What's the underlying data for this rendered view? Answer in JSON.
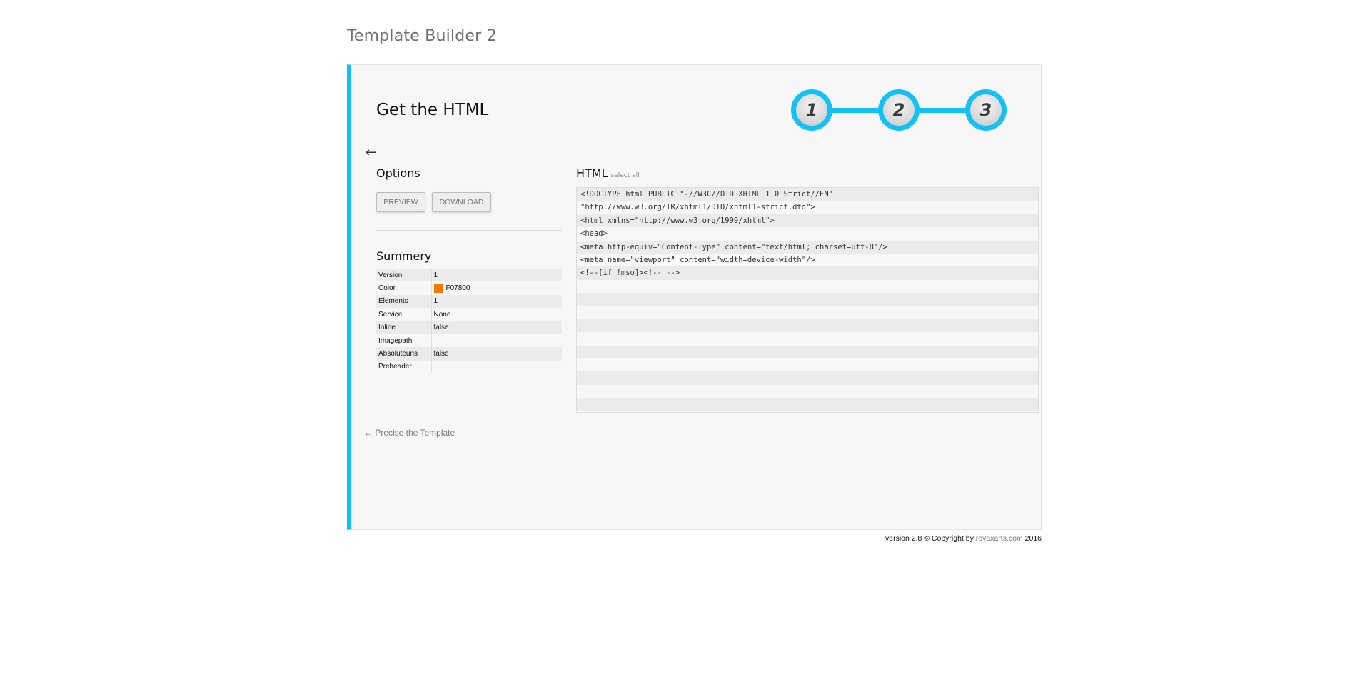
{
  "app": {
    "title": "Template Builder 2"
  },
  "page": {
    "title": "Get the HTML",
    "back_arrow": "←"
  },
  "steps": [
    {
      "number": "1"
    },
    {
      "number": "2"
    },
    {
      "number": "3"
    }
  ],
  "options": {
    "heading": "Options",
    "preview_label": "PREVIEW",
    "download_label": "DOWNLOAD"
  },
  "summary": {
    "heading": "Summery",
    "rows": [
      {
        "key": "Version",
        "value": "1"
      },
      {
        "key": "Color",
        "value": "F07800",
        "swatch": "#F07800"
      },
      {
        "key": "Elements",
        "value": "1"
      },
      {
        "key": "Service",
        "value": "None"
      },
      {
        "key": "Inline",
        "value": "false"
      },
      {
        "key": "Imagepath",
        "value": ""
      },
      {
        "key": "Absoluteurls",
        "value": "false"
      },
      {
        "key": "Preheader",
        "value": ""
      }
    ]
  },
  "html_panel": {
    "heading": "HTML",
    "select_all": "select all",
    "lines": [
      "<!DOCTYPE html PUBLIC \"-//W3C//DTD XHTML 1.0 Strict//EN\"",
      "\"http://www.w3.org/TR/xhtml1/DTD/xhtml1-strict.dtd\">",
      "<html xmlns=\"http://www.w3.org/1999/xhtml\">",
      "<head>",
      "<meta http-equiv=\"Content-Type\" content=\"text/html; charset=utf-8\"/>",
      "<meta name=\"viewport\" content=\"width=device-width\"/>",
      "<!--[if !mso]><!-- -->",
      "",
      "",
      "",
      "",
      "",
      "",
      "",
      "",
      "",
      ""
    ]
  },
  "back_link": {
    "label": "← Precise the Template"
  },
  "footer": {
    "prefix": "version 2.8 © Copyright by ",
    "link": "revaxarts.com",
    "suffix": " 2016"
  },
  "colors": {
    "accent": "#12c2f4",
    "swatch": "#F07800"
  }
}
